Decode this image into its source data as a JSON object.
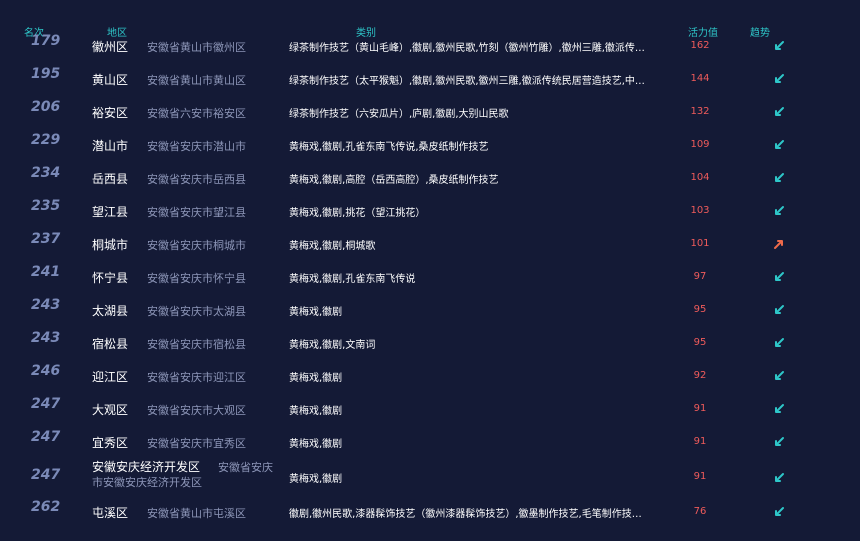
{
  "header": {
    "rank": "名次",
    "region": "地区",
    "category": "类别",
    "vitality": "活力值",
    "trend": "趋势"
  },
  "colors": {
    "background": "#141a36",
    "header": "#2ec7c9",
    "value": "#ef5b5b",
    "down": "#2ec7c9",
    "up": "#ef6a4a"
  },
  "rows": [
    {
      "rank": "179",
      "region": "徽州区",
      "full": "安徽省黄山市徽州区",
      "category": "绿茶制作技艺（黄山毛峰）,徽剧,徽州民歌,竹刻（徽州竹雕）,徽州三雕,徽派传统民居营造技艺",
      "value": "162",
      "trend": "down"
    },
    {
      "rank": "195",
      "region": "黄山区",
      "full": "安徽省黄山市黄山区",
      "category": "绿茶制作技艺（太平猴魁）,徽剧,徽州民歌,徽州三雕,徽派传统民居营造技艺,中医诊法（张一帖内科）",
      "value": "144",
      "trend": "down"
    },
    {
      "rank": "206",
      "region": "裕安区",
      "full": "安徽省六安市裕安区",
      "category": "绿茶制作技艺（六安瓜片）,庐剧,徽剧,大别山民歌",
      "value": "132",
      "trend": "down"
    },
    {
      "rank": "229",
      "region": "潜山市",
      "full": "安徽省安庆市潜山市",
      "category": "黄梅戏,徽剧,孔雀东南飞传说,桑皮纸制作技艺",
      "value": "109",
      "trend": "down"
    },
    {
      "rank": "234",
      "region": "岳西县",
      "full": "安徽省安庆市岳西县",
      "category": "黄梅戏,徽剧,高腔（岳西高腔）,桑皮纸制作技艺",
      "value": "104",
      "trend": "down"
    },
    {
      "rank": "235",
      "region": "望江县",
      "full": "安徽省安庆市望江县",
      "category": "黄梅戏,徽剧,挑花（望江挑花）",
      "value": "103",
      "trend": "down"
    },
    {
      "rank": "237",
      "region": "桐城市",
      "full": "安徽省安庆市桐城市",
      "category": "黄梅戏,徽剧,桐城歌",
      "value": "101",
      "trend": "up"
    },
    {
      "rank": "241",
      "region": "怀宁县",
      "full": "安徽省安庆市怀宁县",
      "category": "黄梅戏,徽剧,孔雀东南飞传说",
      "value": "97",
      "trend": "down"
    },
    {
      "rank": "243",
      "region": "太湖县",
      "full": "安徽省安庆市太湖县",
      "category": "黄梅戏,徽剧",
      "value": "95",
      "trend": "down"
    },
    {
      "rank": "243",
      "region": "宿松县",
      "full": "安徽省安庆市宿松县",
      "category": "黄梅戏,徽剧,文南词",
      "value": "95",
      "trend": "down"
    },
    {
      "rank": "246",
      "region": "迎江区",
      "full": "安徽省安庆市迎江区",
      "category": "黄梅戏,徽剧",
      "value": "92",
      "trend": "down"
    },
    {
      "rank": "247",
      "region": "大观区",
      "full": "安徽省安庆市大观区",
      "category": "黄梅戏,徽剧",
      "value": "91",
      "trend": "down"
    },
    {
      "rank": "247",
      "region": "宜秀区",
      "full": "安徽省安庆市宜秀区",
      "category": "黄梅戏,徽剧",
      "value": "91",
      "trend": "down"
    },
    {
      "rank": "247",
      "region": "安徽安庆经济开发区",
      "full_line1": "安徽省安庆",
      "full_line2": "市安徽安庆经济开发区",
      "category": "黄梅戏,徽剧",
      "value": "91",
      "trend": "down",
      "tall": true
    },
    {
      "rank": "262",
      "region": "屯溪区",
      "full": "安徽省黄山市屯溪区",
      "category": "徽剧,徽州民歌,漆器髹饰技艺（徽州漆器髹饰技艺）,徽墨制作技艺,毛笔制作技艺（徽笔制作技艺）",
      "value": "76",
      "trend": "down"
    }
  ]
}
